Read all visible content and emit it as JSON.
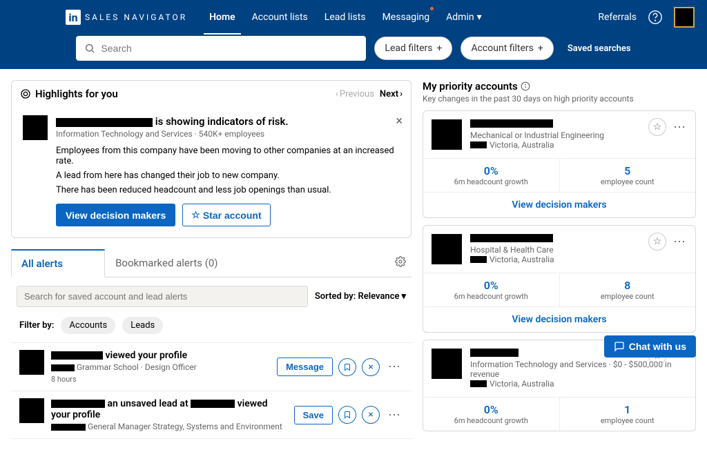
{
  "header": {
    "logo_text": "SALES NAVIGATOR",
    "nav": {
      "home": "Home",
      "account_lists": "Account lists",
      "lead_lists": "Lead lists",
      "messaging": "Messaging",
      "admin": "Admin"
    },
    "referrals": "Referrals"
  },
  "search": {
    "placeholder": "Search",
    "lead_filters": "Lead filters",
    "account_filters": "Account filters",
    "saved": "Saved searches"
  },
  "highlights": {
    "title": "Highlights for you",
    "prev": "Previous",
    "next": "Next",
    "headline_suffix": " is showing indicators of risk.",
    "meta": "Information Technology and Services · 540K+ employees",
    "lines": [
      "Employees from this company have been moving to other companies at an increased rate.",
      "A lead from here has changed their job to new company.",
      "There has been reduced headcount and less job openings than usual."
    ],
    "btn_decision": "View decision makers",
    "btn_star": "Star account"
  },
  "alerts": {
    "tab_all": "All alerts",
    "tab_bookmarked": "Bookmarked alerts (0)",
    "search_placeholder": "Search for saved account and lead alerts",
    "sort_label": "Sorted by: Relevance",
    "filter_by": "Filter by:",
    "filter_accounts": "Accounts",
    "filter_leads": "Leads",
    "items": [
      {
        "headline_suffix": " viewed your profile",
        "sub": " Grammar School · Design Officer",
        "time": "8 hours",
        "action": "Message"
      },
      {
        "headline_mid": " an unsaved lead at ",
        "headline_suffix": " viewed your profile",
        "sub": " General Manager Strategy, Systems and Environment",
        "action": "Save"
      }
    ]
  },
  "priority": {
    "title": "My priority accounts",
    "subtitle": "Key changes in the past 30 days on high priority accounts",
    "view_btn": "View decision makers",
    "stat1_label": "6m headcount growth",
    "stat2_label": "employee count",
    "cards": [
      {
        "industry": "Mechanical or Industrial Engineering",
        "location": "Victoria, Australia",
        "growth": "0%",
        "employees": "5"
      },
      {
        "industry": "Hospital & Health Care",
        "location": "Victoria, Australia",
        "growth": "0%",
        "employees": "8"
      },
      {
        "industry": "Information Technology and Services · $0 - $500,000 in revenue",
        "location": "Victoria, Australia",
        "growth": "0%",
        "employees": "1"
      }
    ]
  },
  "chat": "Chat with us"
}
